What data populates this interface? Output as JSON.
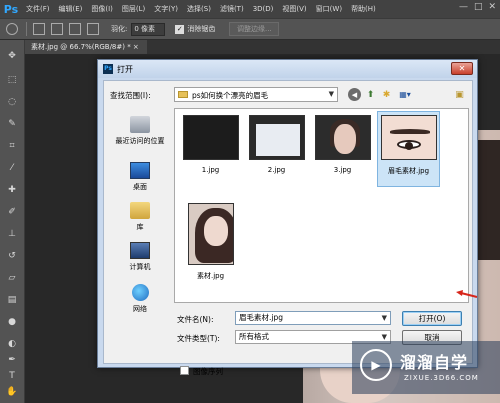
{
  "app": {
    "logo": "Ps",
    "menu": [
      "文件(F)",
      "编辑(E)",
      "图像(I)",
      "图层(L)",
      "文字(Y)",
      "选择(S)",
      "滤镜(T)",
      "3D(D)",
      "视图(V)",
      "窗口(W)",
      "帮助(H)"
    ],
    "window_controls": {
      "minimize": "—",
      "maximize": "□",
      "close": "✕"
    }
  },
  "options": {
    "feather_label": "羽化:",
    "feather_value": "0 像素",
    "antialias_label": "消除锯齿",
    "antialias_checked": "✓",
    "refine_edge": "调整边缘..."
  },
  "document_tab": "素材.jpg @ 66.7%(RGB/8#) * ×",
  "dialog": {
    "title": "打开",
    "close": "✕",
    "look_in_label": "查找范围(I):",
    "look_in_value": "ps如何换个漂亮的眉毛",
    "places": [
      {
        "label": "最近访问的位置",
        "icon": "recent-places-icon"
      },
      {
        "label": "桌面",
        "icon": "desktop-icon"
      },
      {
        "label": "库",
        "icon": "library-icon"
      },
      {
        "label": "计算机",
        "icon": "computer-icon"
      },
      {
        "label": "网络",
        "icon": "network-icon"
      }
    ],
    "files": [
      {
        "name": "1.jpg"
      },
      {
        "name": "2.jpg"
      },
      {
        "name": "3.jpg"
      },
      {
        "name": "眉毛素材.jpg",
        "selected": true
      },
      {
        "name": "素材.jpg"
      }
    ],
    "file_name_label": "文件名(N):",
    "file_name_value": "眉毛素材.jpg",
    "file_type_label": "文件类型(T):",
    "file_type_value": "所有格式",
    "open_button": "打开(O)",
    "cancel_button": "取消",
    "image_sequence_label": "图像序列"
  },
  "watermark": {
    "title": "溜溜自学",
    "url": "ZIXUE.3D66.COM"
  },
  "colors": {
    "ps_blue": "#31a8ff",
    "dialog_frame": "#c9d9ee",
    "annotation_red": "#d7261b"
  }
}
